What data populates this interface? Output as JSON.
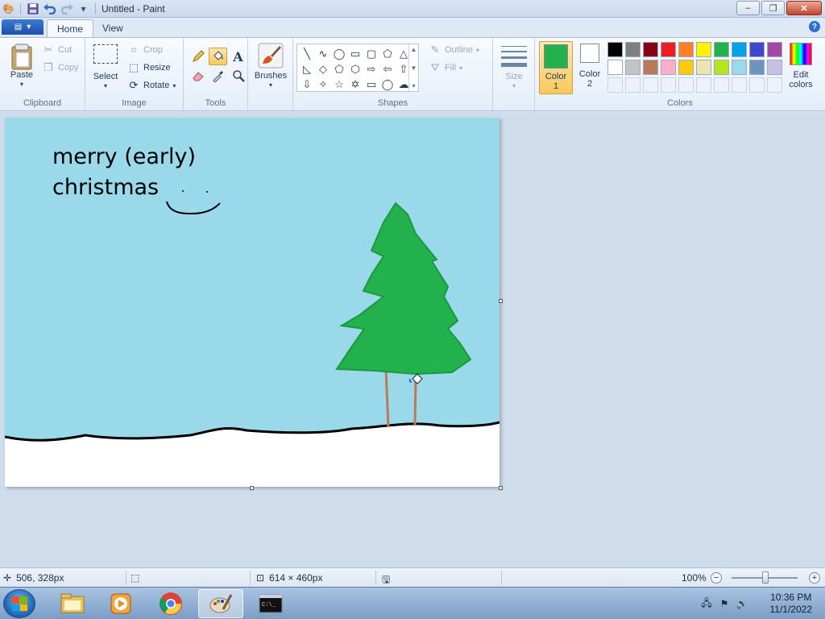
{
  "window": {
    "title": "Untitled - Paint",
    "minimize_label": "–",
    "maximize_label": "❐",
    "close_label": "✕"
  },
  "quick_access": {
    "icons": [
      "paint-app-icon",
      "save-icon",
      "undo-icon",
      "redo-icon",
      "customize-icon"
    ]
  },
  "tabs": [
    {
      "label": "Home",
      "active": true
    },
    {
      "label": "View",
      "active": false
    }
  ],
  "ribbon": {
    "clipboard": {
      "label": "Clipboard",
      "paste": "Paste",
      "cut": "Cut",
      "copy": "Copy"
    },
    "image": {
      "label": "Image",
      "select": "Select",
      "crop": "Crop",
      "resize": "Resize",
      "rotate": "Rotate"
    },
    "tools": {
      "label": "Tools",
      "items": [
        "pencil-icon",
        "fill-icon",
        "text-icon",
        "eraser-icon",
        "color-picker-icon",
        "magnifier-icon"
      ],
      "selected": "fill-icon"
    },
    "brushes": {
      "label": "Brushes"
    },
    "shapes": {
      "label": "Shapes",
      "outline": "Outline",
      "fill": "Fill"
    },
    "size": {
      "label": "Size"
    },
    "colors": {
      "label": "Colors",
      "color1_line1": "Color",
      "color1_line2": "1",
      "color2_line1": "Color",
      "color2_line2": "2",
      "edit_line1": "Edit",
      "edit_line2": "colors",
      "color1": "#22b14c",
      "color2": "#ffffff",
      "palette_row1": [
        "#000000",
        "#7f7f7f",
        "#880015",
        "#ed1c24",
        "#ff7f27",
        "#fff200",
        "#22b14c",
        "#00a2e8",
        "#3f48cc",
        "#a349a4"
      ],
      "palette_row2": [
        "#ffffff",
        "#c3c3c3",
        "#b97a57",
        "#ffaec9",
        "#ffc90e",
        "#efe4b0",
        "#b5e61d",
        "#99d9ea",
        "#7092be",
        "#c8bfe7"
      ]
    }
  },
  "canvas": {
    "text_line1": "merry (early)",
    "text_line2": "christmas",
    "sky_color": "#99d9ea",
    "snow_color": "#ffffff",
    "tree_color": "#22b14c",
    "trunk_color": "#b97a57"
  },
  "status": {
    "cursor_position": "506, 328px",
    "canvas_size": "614 × 460px",
    "zoom": "100%"
  },
  "taskbar": {
    "apps": [
      "file-explorer-icon",
      "media-player-icon",
      "chrome-icon",
      "paint-icon",
      "command-prompt-icon"
    ],
    "time": "10:36 PM",
    "date": "11/1/2022"
  }
}
